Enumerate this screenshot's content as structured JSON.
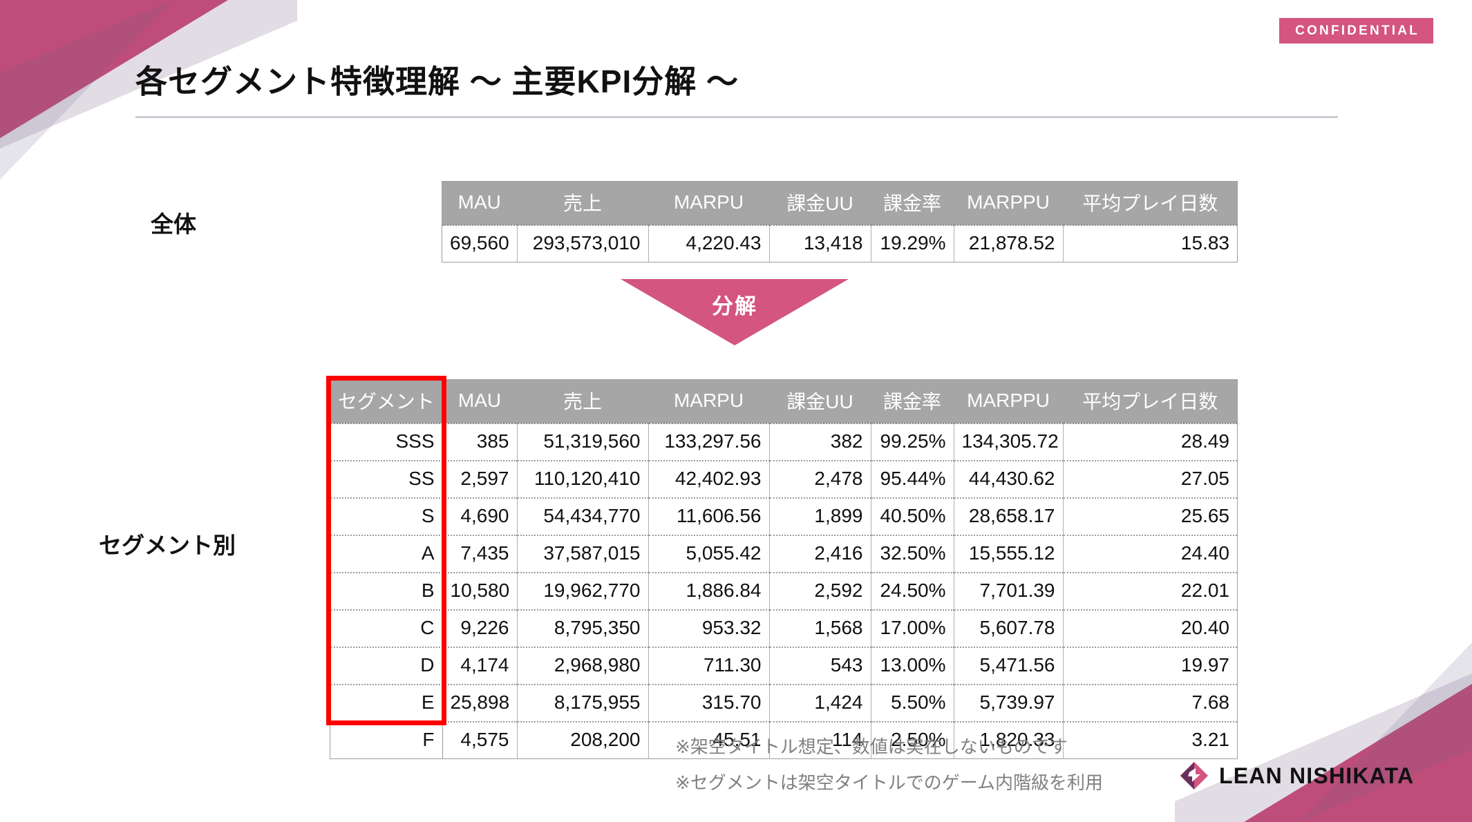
{
  "badge": {
    "label": "CONFIDENTIAL",
    "color": "#d4557f"
  },
  "title": "各セグメント特徴理解 〜 主要KPI分解 〜",
  "labels": {
    "total": "全体",
    "segment": "セグメント別"
  },
  "arrow": {
    "label": "分解",
    "color": "#d4557f"
  },
  "highlight": {
    "color": "#ff0000",
    "target_column": "セグメント"
  },
  "total_table": {
    "headers": [
      "MAU",
      "売上",
      "MARPU",
      "課金UU",
      "課金率",
      "MARPPU",
      "平均プレイ日数"
    ],
    "row": [
      "69,560",
      "293,573,010",
      "4,220.43",
      "13,418",
      "19.29%",
      "21,878.52",
      "15.83"
    ]
  },
  "segment_table": {
    "headers": [
      "セグメント",
      "MAU",
      "売上",
      "MARPU",
      "課金UU",
      "課金率",
      "MARPPU",
      "平均プレイ日数"
    ],
    "rows": [
      [
        "SSS",
        "385",
        "51,319,560",
        "133,297.56",
        "382",
        "99.25%",
        "134,305.72",
        "28.49"
      ],
      [
        "SS",
        "2,597",
        "110,120,410",
        "42,402.93",
        "2,478",
        "95.44%",
        "44,430.62",
        "27.05"
      ],
      [
        "S",
        "4,690",
        "54,434,770",
        "11,606.56",
        "1,899",
        "40.50%",
        "28,658.17",
        "25.65"
      ],
      [
        "A",
        "7,435",
        "37,587,015",
        "5,055.42",
        "2,416",
        "32.50%",
        "15,555.12",
        "24.40"
      ],
      [
        "B",
        "10,580",
        "19,962,770",
        "1,886.84",
        "2,592",
        "24.50%",
        "7,701.39",
        "22.01"
      ],
      [
        "C",
        "9,226",
        "8,795,350",
        "953.32",
        "1,568",
        "17.00%",
        "5,607.78",
        "20.40"
      ],
      [
        "D",
        "4,174",
        "2,968,980",
        "711.30",
        "543",
        "13.00%",
        "5,471.56",
        "19.97"
      ],
      [
        "E",
        "25,898",
        "8,175,955",
        "315.70",
        "1,424",
        "5.50%",
        "5,739.97",
        "7.68"
      ],
      [
        "F",
        "4,575",
        "208,200",
        "45.51",
        "114",
        "2.50%",
        "1,820.33",
        "3.21"
      ]
    ]
  },
  "footnotes": [
    "※架空タイトル想定、数値は実在しないものです",
    "※セグメントは架空タイトルでのゲーム内階級を利用"
  ],
  "logo": {
    "text": "LEAN NISHIKATA",
    "mark_colors": [
      "#6b2f5e",
      "#d4557f"
    ]
  },
  "chart_data": {
    "type": "table",
    "title": "各セグメント特徴理解 〜 主要KPI分解 〜",
    "categories": [
      "SSS",
      "SS",
      "S",
      "A",
      "B",
      "C",
      "D",
      "E",
      "F"
    ],
    "series": [
      {
        "name": "MAU",
        "values": [
          385,
          2597,
          4690,
          7435,
          10580,
          9226,
          4174,
          25898,
          4575
        ]
      },
      {
        "name": "売上",
        "values": [
          51319560,
          110120410,
          54434770,
          37587015,
          19962770,
          8795350,
          2968980,
          8175955,
          208200
        ]
      },
      {
        "name": "MARPU",
        "values": [
          133297.56,
          42402.93,
          11606.56,
          5055.42,
          1886.84,
          953.32,
          711.3,
          315.7,
          45.51
        ]
      },
      {
        "name": "課金UU",
        "values": [
          382,
          2478,
          1899,
          2416,
          2592,
          1568,
          543,
          1424,
          114
        ]
      },
      {
        "name": "課金率",
        "values": [
          99.25,
          95.44,
          40.5,
          32.5,
          24.5,
          17.0,
          13.0,
          5.5,
          2.5
        ]
      },
      {
        "name": "MARPPU",
        "values": [
          134305.72,
          44430.62,
          28658.17,
          15555.12,
          7701.39,
          5607.78,
          5471.56,
          5739.97,
          1820.33
        ]
      },
      {
        "name": "平均プレイ日数",
        "values": [
          28.49,
          27.05,
          25.65,
          24.4,
          22.01,
          20.4,
          19.97,
          7.68,
          3.21
        ]
      }
    ],
    "totals": {
      "MAU": 69560,
      "売上": 293573010,
      "MARPU": 4220.43,
      "課金UU": 13418,
      "課金率": 19.29,
      "MARPPU": 21878.52,
      "平均プレイ日数": 15.83
    },
    "xlabel": "セグメント",
    "ylabel": "",
    "grid": true,
    "legend": "none"
  }
}
